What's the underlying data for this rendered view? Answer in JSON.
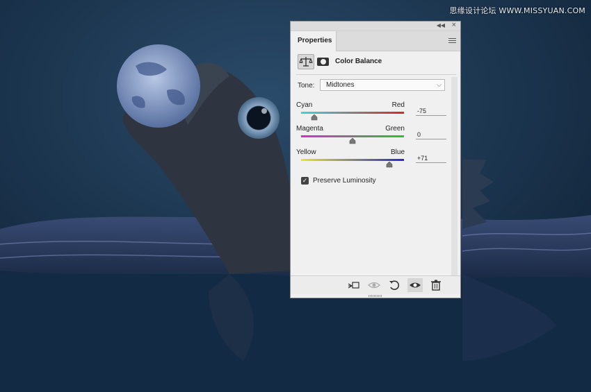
{
  "watermark": "思缘设计论坛 WWW.MISSYUAN.COM",
  "panel": {
    "tab_label": "Properties",
    "title": "Color Balance",
    "tone_label": "Tone:",
    "tone_value": "Midtones",
    "sliders": [
      {
        "left_label": "Cyan",
        "right_label": "Red",
        "value": "-75",
        "position": 0.125,
        "gradient": [
          "#3ad6d6",
          "#d62828"
        ]
      },
      {
        "left_label": "Magenta",
        "right_label": "Green",
        "value": "0",
        "position": 0.5,
        "gradient": [
          "#d62bd6",
          "#28c628"
        ]
      },
      {
        "left_label": "Yellow",
        "right_label": "Blue",
        "value": "+71",
        "position": 0.855,
        "gradient": [
          "#e6e628",
          "#2828c8"
        ]
      }
    ],
    "preserve_luminosity_label": "Preserve Luminosity",
    "preserve_luminosity_checked": true
  },
  "icons": {
    "topbar": [
      "collapse-icon",
      "close-icon",
      "panel-menu-icon"
    ],
    "bottom": [
      "clip-to-layer-icon",
      "view-previous-state-icon",
      "reset-icon",
      "visibility-icon",
      "trash-icon"
    ]
  },
  "colors": {
    "panel_bg": "#f0f0f0",
    "canvas_bg": "#0f2236"
  }
}
